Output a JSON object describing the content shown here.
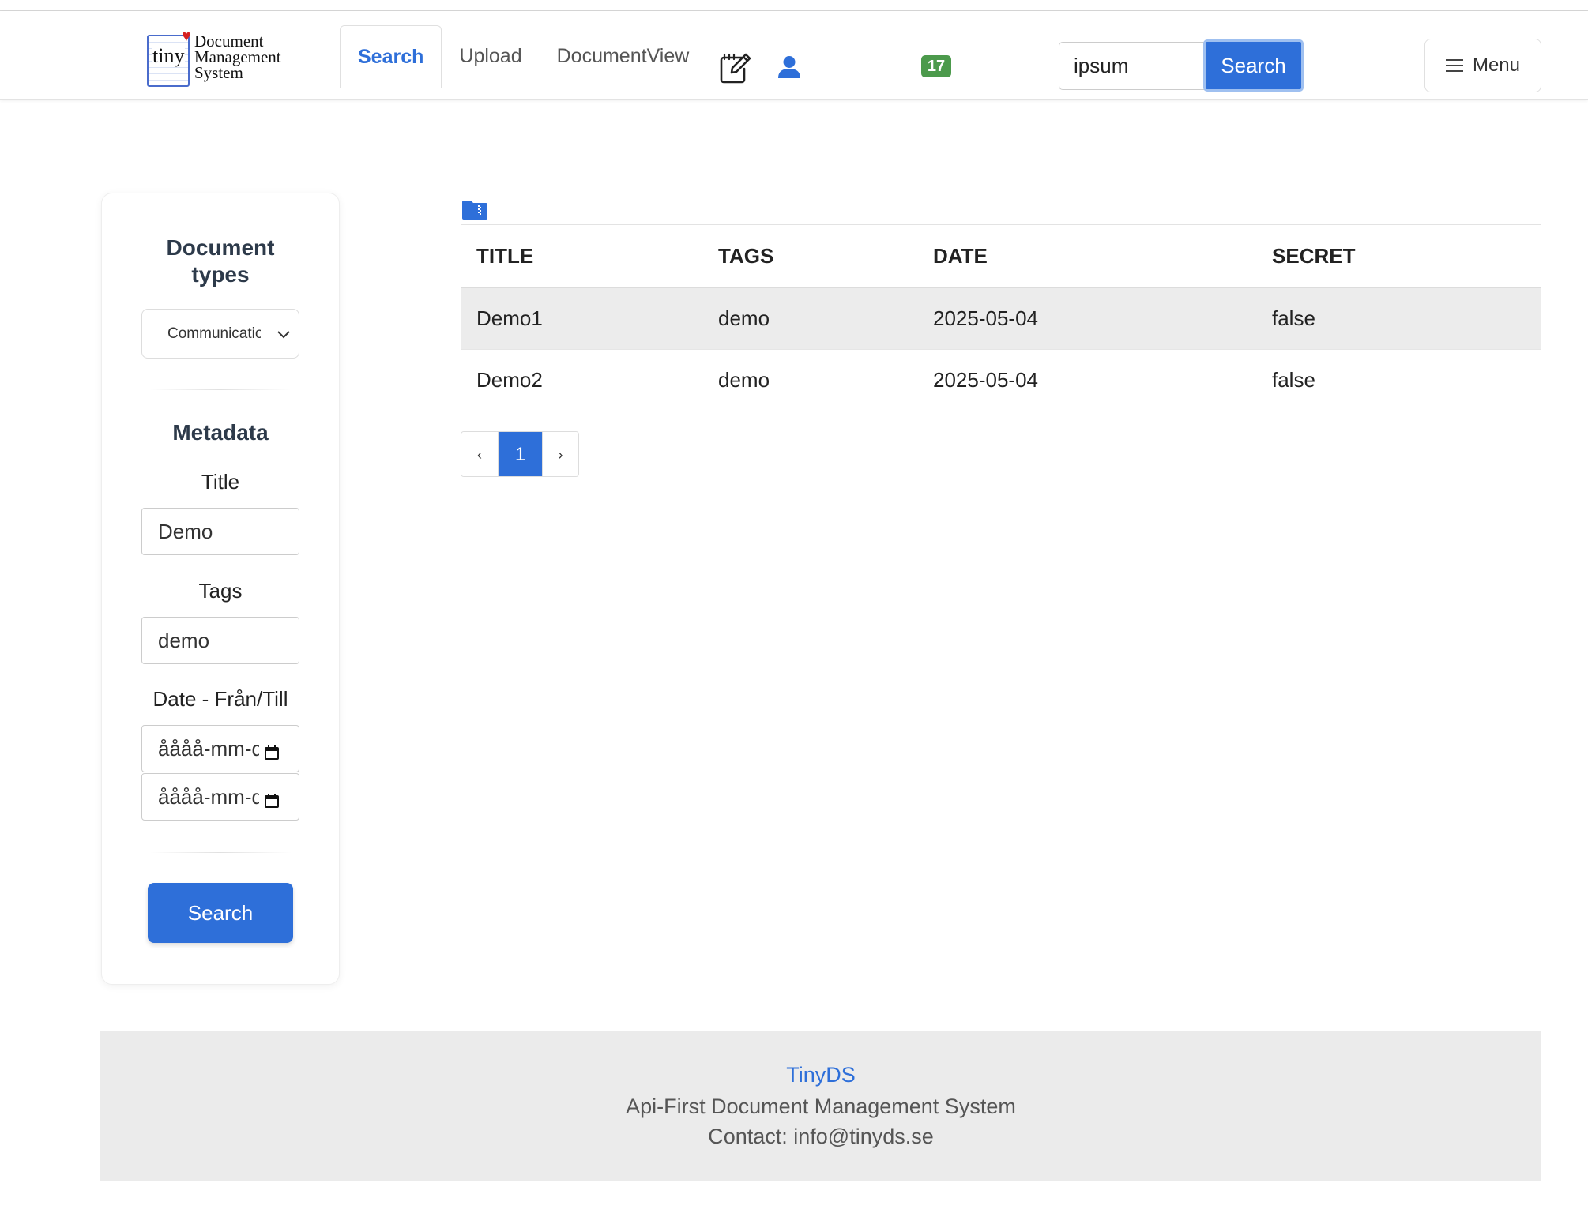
{
  "logo": {
    "tiny": "tiny",
    "line1": "Document",
    "line2": "Management",
    "line3": "System"
  },
  "nav": {
    "tabs": [
      {
        "label": "Search",
        "active": true
      },
      {
        "label": "Upload",
        "active": false
      },
      {
        "label": "DocumentView",
        "active": false
      }
    ],
    "edit_icon": "edit-note-icon",
    "user_icon": "user-icon",
    "badge_count": "17",
    "search_value": "ipsum",
    "search_button": "Search",
    "menu_label": "Menu"
  },
  "sidebar": {
    "doc_types_heading_1": "Document",
    "doc_types_heading_2": "types",
    "doc_type_selected": "Communication",
    "metadata_heading": "Metadata",
    "title_label": "Title",
    "title_value": "Demo",
    "tags_label": "Tags",
    "tags_value": "demo",
    "date_label": "Date - Från/Till",
    "date_from_placeholder": "åååå-mm-dd",
    "date_to_placeholder": "åååå-mm-dd",
    "search_button": "Search"
  },
  "table": {
    "columns": [
      "Title",
      "Tags",
      "Date",
      "Secret"
    ],
    "rows": [
      {
        "title": "Demo1",
        "tags": "demo",
        "date": "2025-05-04",
        "secret": "false"
      },
      {
        "title": "Demo2",
        "tags": "demo",
        "date": "2025-05-04",
        "secret": "false"
      }
    ]
  },
  "pagination": {
    "prev": "‹",
    "current": "1",
    "next": "›"
  },
  "footer": {
    "brand": "TinyDS",
    "tagline": "Api-First Document Management System",
    "contact": "Contact: info@tinyds.se"
  },
  "colors": {
    "accent": "#2e6fd9",
    "badge": "#4c9a4c",
    "footer_bg": "#ebebeb"
  }
}
